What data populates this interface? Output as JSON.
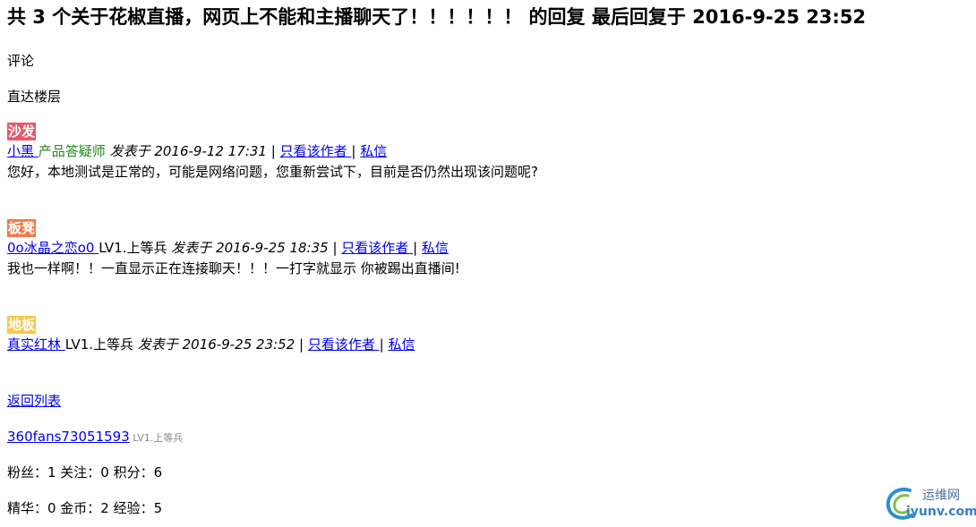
{
  "page": {
    "title": "共 3 个关于花椒直播，网页上不能和主播聊天了！！！！！！ 的回复 最后回复于 2016-9-25 23:52",
    "comment_label": "评论",
    "jump_label": "直达楼层"
  },
  "floors": [
    {
      "tag": "沙发",
      "tag_color": "#e8586a",
      "user": " 小黑 ",
      "role": "产品答疑师",
      "posted": "发表于 2016-9-12 17:31",
      "only_author": "只看该作者 ",
      "pm": "私信",
      "content": "您好，本地测试是正常的，可能是网络问题，您重新尝试下，目前是否仍然出现该问题呢?"
    },
    {
      "tag": "板凳",
      "tag_color": "#f07a4c",
      "user": "0o冰晶之恋o0 ",
      "role": "LV1.上等兵",
      "posted": "发表于 2016-9-25 18:35",
      "only_author": "只看该作者 ",
      "pm": "私信",
      "content": "我也一样啊！！一直显示正在连接聊天！！！一打字就显示 你被踢出直播间!"
    },
    {
      "tag": "地板",
      "tag_color": "#f7c84a",
      "user": "真实红林 ",
      "role": "LV1.上等兵",
      "posted": "发表于 2016-9-25 23:52",
      "only_author": "只看该作者 ",
      "pm": "私信",
      "content": ""
    }
  ],
  "footer": {
    "back_label": "返回列表",
    "username": "360fans73051593",
    "level": " LV1.上等兵",
    "stats_1": "粉丝：1 关注：0 积分：6",
    "stats_2": "精华：0 金币：2 经验：5"
  },
  "watermark": {
    "line1": "运维网",
    "line2": "iyunv.com"
  }
}
